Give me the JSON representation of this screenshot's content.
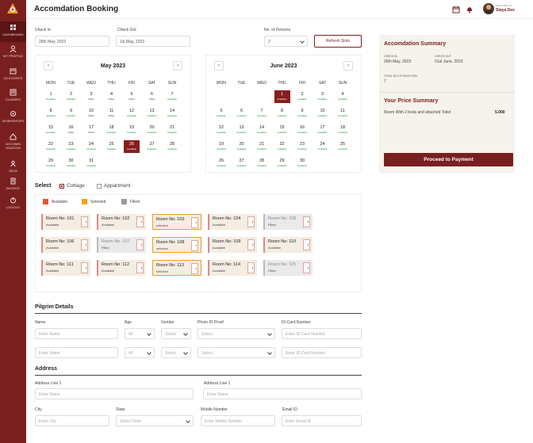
{
  "sidebar": {
    "items": [
      {
        "label": "DASHBOARD",
        "icon": "dashboard-icon"
      },
      {
        "label": "MY PROFILE",
        "icon": "profile-icon"
      },
      {
        "label": "ACCOUNTS",
        "icon": "accounts-icon"
      },
      {
        "label": "CLASSES",
        "icon": "classes-icon"
      },
      {
        "label": "WORKSHOPS",
        "icon": "workshops-icon"
      },
      {
        "label": "ACCOMM ODATION",
        "icon": "accommodation-icon"
      },
      {
        "label": "SEVA",
        "icon": "seva-icon"
      },
      {
        "label": "INVOICE",
        "icon": "invoice-icon"
      },
      {
        "label": "LOGOUT",
        "icon": "logout-icon"
      }
    ]
  },
  "header": {
    "title": "Accomdation Booking",
    "welcome": "WELCOME TO",
    "user_name": "Staya Dev"
  },
  "form": {
    "check_in_label": "Check In",
    "check_in_value": "26th May, 2023",
    "check_out_label": "Check Out",
    "check_out_value": "1st May, 2023",
    "persons_label": "No. of Persons",
    "persons_value": "2",
    "refresh_label": "Refresh Slots"
  },
  "calendars": [
    {
      "month": "May 2023",
      "weekdays": [
        "MON",
        "TUE",
        "WED",
        "THU",
        "FRI",
        "SAT",
        "SUN"
      ],
      "weeks": [
        [
          [
            "1",
            "Available"
          ],
          [
            "2",
            "Available"
          ],
          [
            "3",
            "Filled"
          ],
          [
            "4",
            "Filled"
          ],
          [
            "5",
            "Filled"
          ],
          [
            "6",
            "Filled"
          ],
          [
            "7",
            "Available"
          ]
        ],
        [
          [
            "8",
            "Available"
          ],
          [
            "9",
            "Available"
          ],
          [
            "10",
            "Filled"
          ],
          [
            "11",
            "Filled"
          ],
          [
            "12",
            "Available"
          ],
          [
            "13",
            "Available"
          ],
          [
            "14",
            "Available"
          ]
        ],
        [
          [
            "15",
            "Available"
          ],
          [
            "16",
            "Filled"
          ],
          [
            "17",
            "Filled"
          ],
          [
            "18",
            "Available"
          ],
          [
            "19",
            "Available"
          ],
          [
            "20",
            "Available"
          ],
          [
            "21",
            "Available"
          ]
        ],
        [
          [
            "22",
            "Available"
          ],
          [
            "23",
            "Available"
          ],
          [
            "24",
            "Available"
          ],
          [
            "25",
            "Available"
          ],
          [
            "26",
            "Available"
          ],
          [
            "27",
            "Available"
          ],
          [
            "28",
            "Available"
          ]
        ],
        [
          [
            "29",
            "Available"
          ],
          [
            "30",
            "Available"
          ],
          [
            "31",
            "Available"
          ]
        ]
      ],
      "selected": "26"
    },
    {
      "month": "June 2023",
      "weekdays": [
        "MON",
        "TUE",
        "WED",
        "THU",
        "FRI",
        "SAT",
        "SUN"
      ],
      "weeks": [
        [
          [],
          [],
          [],
          [
            "1",
            "Available"
          ],
          [
            "2",
            "Available"
          ],
          [
            "3",
            "Available"
          ],
          [
            "4",
            "Available"
          ]
        ],
        [
          [
            "5",
            "Available"
          ],
          [
            "6",
            "Available"
          ],
          [
            "7",
            "Available"
          ],
          [
            "8",
            "Available"
          ],
          [
            "9",
            "Available"
          ],
          [
            "10",
            "Available"
          ],
          [
            "11",
            "Available"
          ]
        ],
        [
          [
            "12",
            "Available"
          ],
          [
            "13",
            "Available"
          ],
          [
            "14",
            "Available"
          ],
          [
            "15",
            "Available"
          ],
          [
            "16",
            "Available"
          ],
          [
            "17",
            "Available"
          ],
          [
            "18",
            "Available"
          ]
        ],
        [
          [
            "19",
            "Available"
          ],
          [
            "20",
            "Available"
          ],
          [
            "21",
            "Available"
          ],
          [
            "22",
            "Available"
          ],
          [
            "23",
            "Available"
          ],
          [
            "24",
            "Available"
          ],
          [
            "25",
            "Available"
          ]
        ],
        [
          [
            "26",
            "Available"
          ],
          [
            "27",
            "Available"
          ],
          [
            "28",
            "Available"
          ],
          [
            "29",
            "Available"
          ],
          [
            "30",
            "Available"
          ]
        ]
      ],
      "selected": "1"
    }
  ],
  "summary": {
    "title": "Accomdation Summary",
    "check_in_key": "CHECK IN",
    "check_in_value": "26th May, 2023",
    "check_out_key": "CHECK OUT",
    "check_out_value": "01st June, 2023",
    "days_key": "TOTAL NO OF DAYS STAY",
    "days_value": "7",
    "price_title": "Your Price Summary",
    "price_item": "Room With 2 beds and attached Toilet",
    "price_value": "5.000",
    "proceed_label": "Proceed to Payment"
  },
  "select": {
    "label": "Select",
    "cottage": "Cottage",
    "apartment": "Appartment",
    "legend": [
      {
        "label": "Available",
        "color": "#e8542a"
      },
      {
        "label": "Selected",
        "color": "#f4a21c"
      },
      {
        "label": "Filled",
        "color": "#9a9a9a"
      }
    ]
  },
  "rooms": [
    [
      [
        "Room No: 101",
        "Available",
        "av"
      ],
      [
        "Room No: 102",
        "Available",
        "av"
      ],
      [
        "Room No: 103",
        "selected",
        "se"
      ],
      [
        "Room No: 104",
        "Available",
        "av"
      ],
      [
        "Room No: 105",
        "Filled",
        "fi"
      ]
    ],
    [
      [
        "Room No: 106",
        "Available",
        "av"
      ],
      [
        "Room No: 107",
        "Filled",
        "fi"
      ],
      [
        "Room No: 108",
        "selected",
        "se"
      ],
      [
        "Room No: 109",
        "Available",
        "av"
      ],
      [
        "Room No: 110",
        "Available",
        "av"
      ]
    ],
    [
      [
        "Room No: 111",
        "Available",
        "av"
      ],
      [
        "Room No: 112",
        "Available",
        "av"
      ],
      [
        "Room No: 113",
        "selected",
        "se"
      ],
      [
        "Room No: 114",
        "Available",
        "av"
      ],
      [
        "Room No: 115",
        "Filled",
        "fi"
      ]
    ]
  ],
  "pilgrim": {
    "title": "Pilgrim Details",
    "name_label": "Name",
    "age_label": "Age",
    "gender_label": "Gender",
    "photo_label": "Photo ID Proof",
    "idcard_label": "ID-Card Number",
    "name_ph": "Enter Name",
    "age_ph": "40",
    "gender_ph": "Select",
    "photo_ph": "Select",
    "idcard_ph": "Enter ID-Card Number"
  },
  "address": {
    "title": "Address",
    "line1_label": "Address Line 1",
    "line1b_label": "Address Line 1",
    "line_ph": "Enter Name",
    "city_label": "City",
    "city_ph": "Enter City",
    "state_label": "State",
    "state_ph": "Select State",
    "mobile_label": "Mobile Number",
    "mobile_ph": "Enter Mobile Number",
    "email_label": "Email ID",
    "email_ph": "Enter Email ID"
  }
}
